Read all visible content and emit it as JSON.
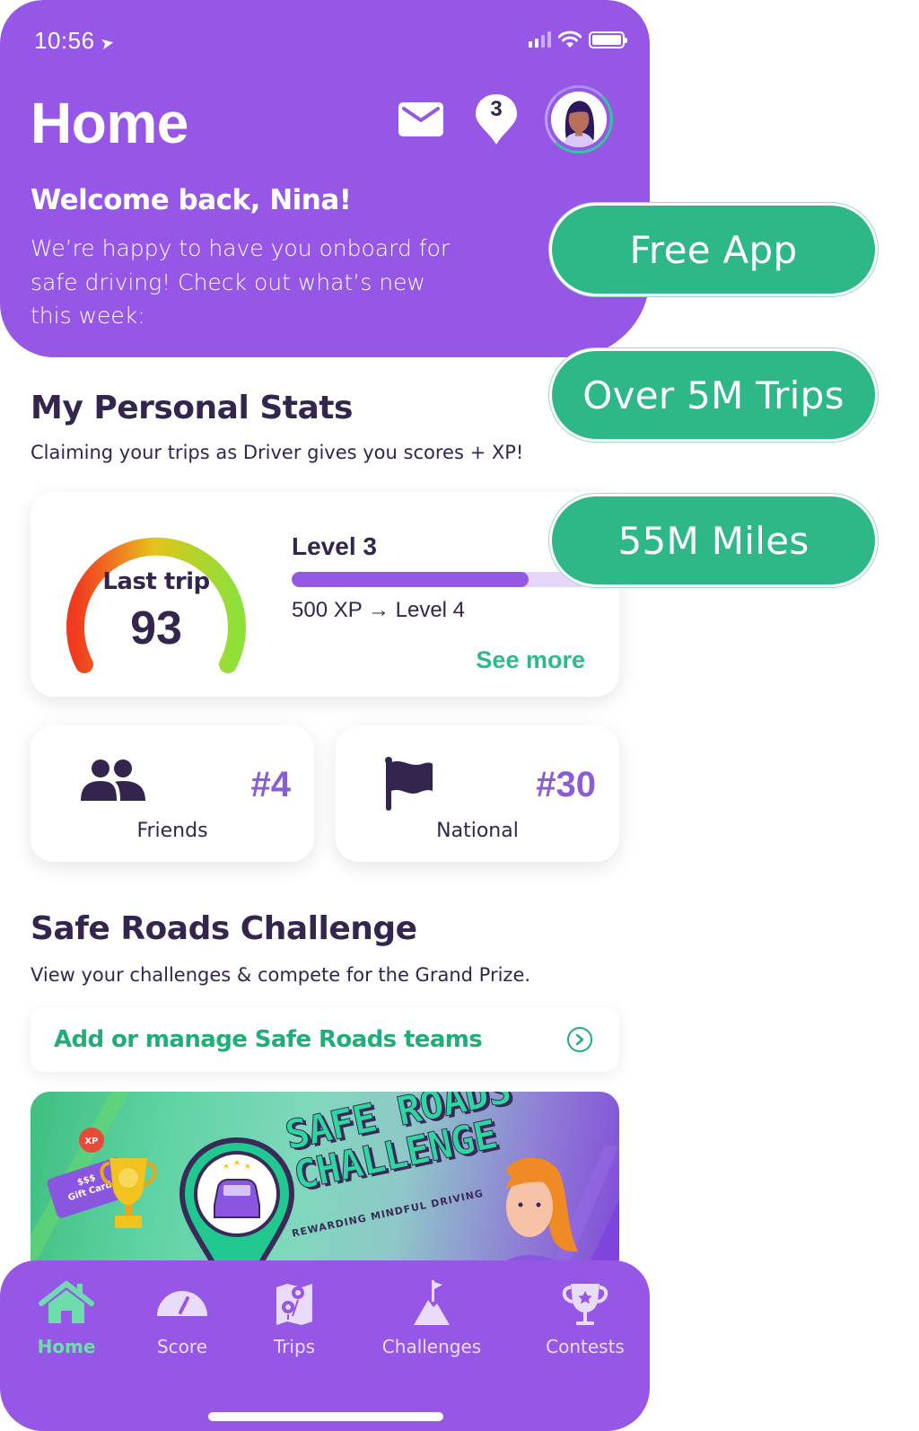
{
  "status_bar": {
    "time": "10:56",
    "location_icon": "location-arrow-icon",
    "icons": [
      "signal-icon",
      "wifi-icon",
      "battery-icon"
    ]
  },
  "header": {
    "title": "Home",
    "notification_count": "3",
    "icons": [
      "mail-icon",
      "notification-pin-icon",
      "avatar"
    ]
  },
  "welcome": {
    "title": "Welcome back, Nina!",
    "text": "We’re happy to have you onboard for safe driving! Check out what’s new this week:"
  },
  "personal_stats": {
    "title": "My Personal Stats",
    "subtitle": "Claiming your trips as Driver gives you scores + XP!",
    "gauge": {
      "label": "Last trip",
      "score": "93",
      "colors": {
        "low": "#f03a1e",
        "mid": "#e8c21a",
        "high": "#8fe03a"
      }
    },
    "level": {
      "title": "Level 3",
      "progress_percent": 80,
      "xp_text": "500 XP → Level 4"
    },
    "see_more": "See more"
  },
  "ranks": [
    {
      "icon": "friends-icon",
      "value": "#4",
      "label": "Friends"
    },
    {
      "icon": "flag-icon",
      "value": "#30",
      "label": "National"
    }
  ],
  "challenge": {
    "title": "Safe Roads Challenge",
    "subtitle": "View your challenges & compete for the Grand Prize.",
    "manage_link": "Add or manage Safe Roads teams",
    "banner": {
      "title_line1": "SAFE ROADS",
      "title_line2": "CHALLENGE",
      "tagline": "REWARDING MINDFUL DRIVING",
      "giftcard_line1": "$$$",
      "giftcard_line2": "Gift Card",
      "badge": "XP"
    }
  },
  "bottom_nav": {
    "items": [
      {
        "label": "Home",
        "icon": "home-icon",
        "active": true
      },
      {
        "label": "Score",
        "icon": "speedometer-icon",
        "active": false
      },
      {
        "label": "Trips",
        "icon": "map-icon",
        "active": false
      },
      {
        "label": "Challenges",
        "icon": "mountain-flag-icon",
        "active": false
      },
      {
        "label": "Contests",
        "icon": "trophy-icon",
        "active": false
      }
    ]
  },
  "promo_pills": [
    "Free App",
    "Over 5M Trips",
    "55M Miles"
  ],
  "colors": {
    "brand_purple": "#9757e6",
    "accent_green": "#2eb888",
    "text_dark": "#33254d",
    "rank_purple": "#8b5cd6"
  }
}
